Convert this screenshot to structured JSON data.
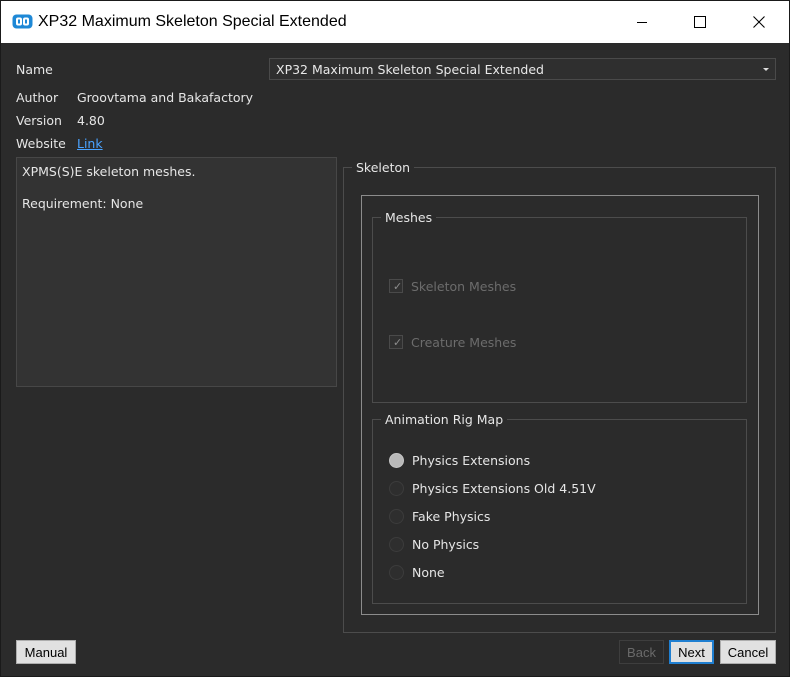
{
  "window": {
    "title": "XP32 Maximum Skeleton Special Extended",
    "controls": {
      "minimize": "minimize-icon",
      "maximize": "maximize-icon",
      "close": "close-icon"
    }
  },
  "info": {
    "name_label": "Name",
    "name_value": "XP32 Maximum Skeleton Special Extended",
    "author_label": "Author",
    "author_value": "Groovtama and Bakafactory",
    "version_label": "Version",
    "version_value": "4.80",
    "website_label": "Website",
    "website_link": "Link"
  },
  "description": {
    "line1": "XPMS(S)E skeleton meshes.",
    "line2": "Requirement: None"
  },
  "skeleton": {
    "title": "Skeleton",
    "meshes": {
      "title": "Meshes",
      "options": [
        {
          "label": "Skeleton Meshes",
          "checked": true,
          "enabled": false
        },
        {
          "label": "Creature Meshes",
          "checked": true,
          "enabled": false
        }
      ]
    },
    "rig_map": {
      "title": "Animation Rig Map",
      "selected": "Physics Extensions",
      "options": [
        {
          "label": "Physics Extensions"
        },
        {
          "label": "Physics Extensions Old 4.51V"
        },
        {
          "label": "Fake Physics"
        },
        {
          "label": "No Physics"
        },
        {
          "label": "None"
        }
      ]
    }
  },
  "buttons": {
    "manual": "Manual",
    "back": "Back",
    "next": "Next",
    "cancel": "Cancel"
  },
  "colors": {
    "background": "#2b2b2b",
    "link": "#4aa3ff",
    "default_button_border": "#1f7fd1"
  }
}
